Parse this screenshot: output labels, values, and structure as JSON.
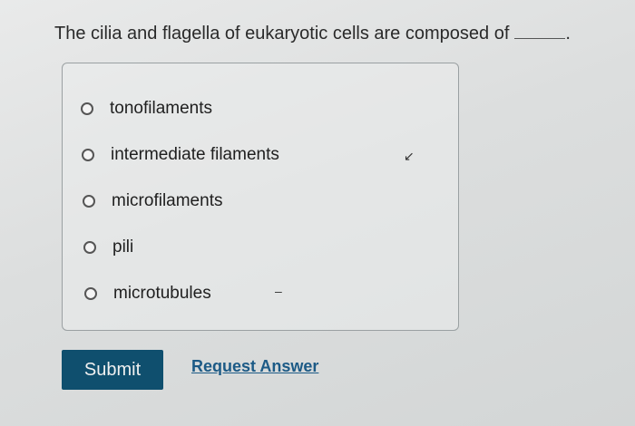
{
  "question": {
    "text": "The cilia and flagella of eukaryotic cells are composed of",
    "blank_end": "."
  },
  "options": [
    {
      "label": "tonofilaments"
    },
    {
      "label": "intermediate filaments"
    },
    {
      "label": "microfilaments"
    },
    {
      "label": "pili"
    },
    {
      "label": "microtubules"
    }
  ],
  "actions": {
    "submit_label": "Submit",
    "request_answer_label": "Request Answer"
  }
}
